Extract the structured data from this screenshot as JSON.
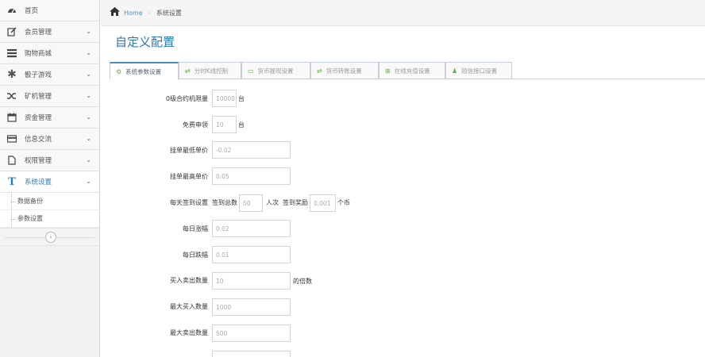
{
  "sidebar": {
    "items": [
      {
        "label": "首页",
        "icon": "dashboard-icon"
      },
      {
        "label": "会员管理",
        "icon": "edit-icon"
      },
      {
        "label": "购物商城",
        "icon": "list-icon"
      },
      {
        "label": "骰子游戏",
        "icon": "asterisk-icon"
      },
      {
        "label": "矿机管理",
        "icon": "random-icon"
      },
      {
        "label": "资金管理",
        "icon": "calendar-icon"
      },
      {
        "label": "信息交流",
        "icon": "credit-card-icon"
      },
      {
        "label": "权限管理",
        "icon": "file-icon"
      },
      {
        "label": "系统设置",
        "icon": "text-width-icon"
      }
    ],
    "sub_items": [
      "数据备份",
      "参数设置"
    ],
    "collapse_glyph": "«"
  },
  "breadcrumb": {
    "home": "Home",
    "current": "系统设置"
  },
  "page_title": "自定义配置",
  "tabs": [
    {
      "label": "系统参数设置",
      "icon": "cogs-icon"
    },
    {
      "label": "分时K线控制",
      "icon": "exchange-icon"
    },
    {
      "label": "货币提现设置",
      "icon": "credit-card-icon"
    },
    {
      "label": "货币转账设置",
      "icon": "exchange-icon"
    },
    {
      "label": "在线充值设置",
      "icon": "plus-square-icon"
    },
    {
      "label": "短信接口设置",
      "icon": "user-icon"
    }
  ],
  "form": {
    "r0": {
      "label": "0级合约机限量",
      "value": "10000",
      "unit": "台"
    },
    "r1": {
      "label": "免费申领",
      "value": "10",
      "unit": "台"
    },
    "r2": {
      "label": "挂单最低单价",
      "value": "-0.02"
    },
    "r3": {
      "label": "挂单最高单价",
      "value": "0.05"
    },
    "r4": {
      "label": "每天签到设置",
      "pre1": "签到总数",
      "value1": "50",
      "mid": "人次",
      "pre2": "签到奖励",
      "value2": "0.001",
      "unit": "个币"
    },
    "r5": {
      "label": "每日涨幅",
      "value": "0.02"
    },
    "r6": {
      "label": "每日跌幅",
      "value": "0.01"
    },
    "r7": {
      "label": "买入卖出数量",
      "value": "10",
      "unit": "的倍数"
    },
    "r8": {
      "label": "最大买入数量",
      "value": "1000"
    },
    "r9": {
      "label": "最大卖出数量",
      "value": "500"
    }
  },
  "colors": {
    "accent": "#2679b5",
    "link": "#4c8fbd",
    "active_tab_icon": "#69aa46"
  }
}
